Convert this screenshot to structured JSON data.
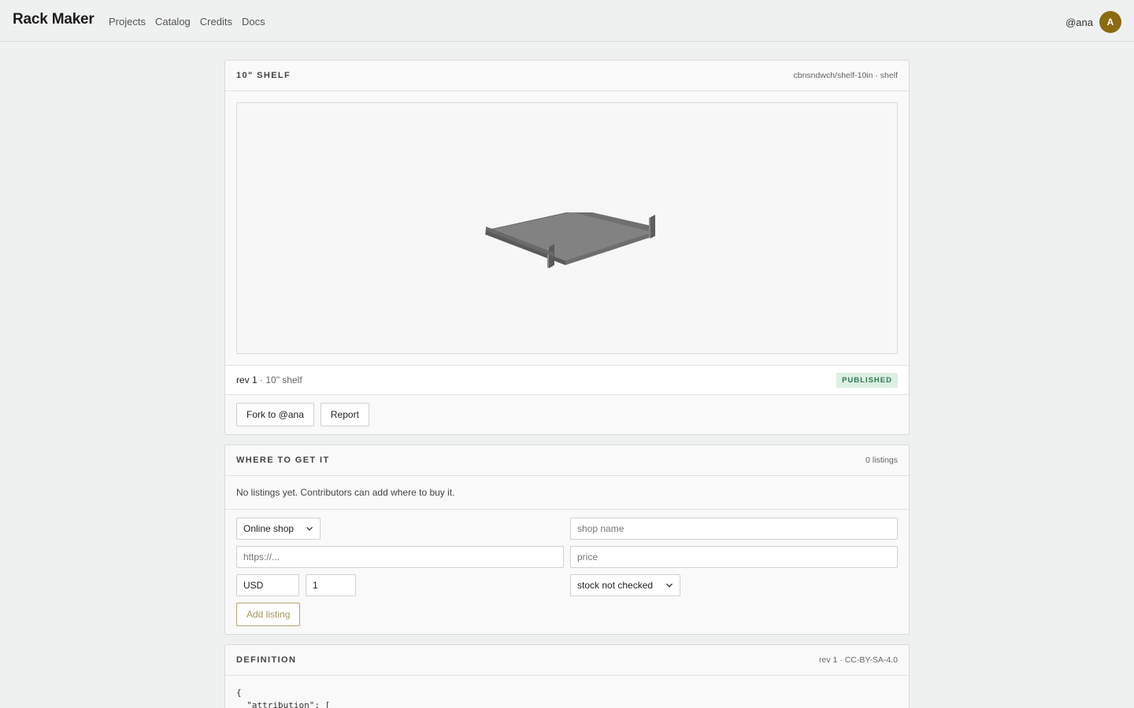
{
  "nav": {
    "brand": "Rack Maker",
    "links": [
      "Projects",
      "Catalog",
      "Credits",
      "Docs"
    ],
    "user_name": "@ana",
    "avatar_initial": "A",
    "avatar_color": "#8b6a14"
  },
  "item": {
    "title": "10\" SHELF",
    "meta": "cbnsndwch/shelf-10in · shelf",
    "rev_label": "rev 1",
    "rev_sub": "· 10\" shelf",
    "status": "PUBLISHED",
    "actions": {
      "fork_label": "Fork to @ana",
      "report_label": "Report"
    }
  },
  "listings": {
    "title": "WHERE TO GET IT",
    "count": "0 listings",
    "empty_message": "No listings yet. Contributors can add where to buy it.",
    "form": {
      "type_value": "Online shop",
      "shop_placeholder": "shop name",
      "url_placeholder": "https://...",
      "price_placeholder": "price",
      "currency_value": "USD",
      "quantity_value": "1",
      "stock_value": "stock not checked",
      "add_label": "Add listing"
    }
  },
  "definition": {
    "title": "DEFINITION",
    "meta": "rev 1 · CC-BY-SA-4.0",
    "code_lines": [
      "{",
      "  \"attribution\": ["
    ]
  }
}
